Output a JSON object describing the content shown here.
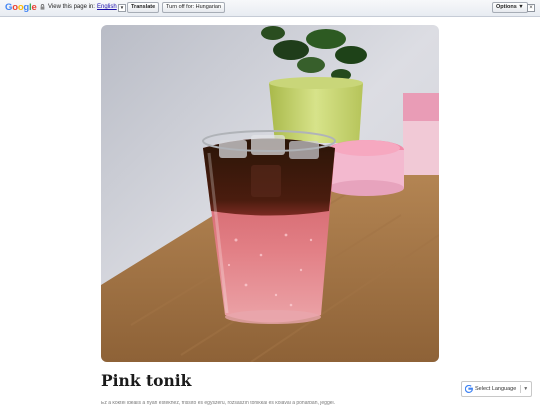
{
  "translate_bar": {
    "logo": [
      "G",
      "o",
      "o",
      "g",
      "l",
      "e"
    ],
    "prompt": "View this page in:",
    "language": "English",
    "language_caret": "▼",
    "translate_button": "Translate",
    "turn_off_button": "Turn off for: Hungarian",
    "options_button": "Options ▼",
    "close_glyph": "×"
  },
  "post": {
    "title": "Pink tonik",
    "snippet": "Ez a koktél ideális a nyári estékhez, frissítő és egyszerű, rózsaszín tonikkal és kólával a pohárban, jéggel."
  },
  "language_widget": {
    "label": "Select Language",
    "caret": "▼"
  }
}
